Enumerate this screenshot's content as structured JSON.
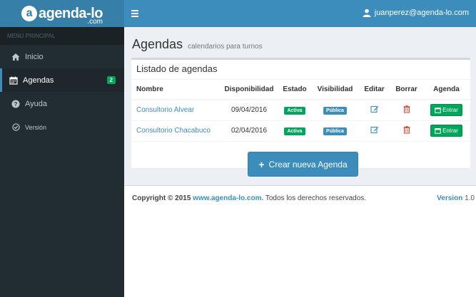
{
  "brand": {
    "mark": "a",
    "name": "agenda-lo",
    "sub": ".com"
  },
  "header": {
    "user_email": "juanperez@agenda-lo.com"
  },
  "sidebar": {
    "header": "MENU PRINCIPAL",
    "items": [
      {
        "label": "Inicio",
        "icon": "home-icon"
      },
      {
        "label": "Agendas",
        "icon": "calendar-icon",
        "badge": "2"
      },
      {
        "label": "Ayuda",
        "icon": "question-circle-icon"
      },
      {
        "label": "Versión",
        "icon": "check-circle-icon"
      }
    ]
  },
  "page": {
    "title": "Agendas",
    "subtitle": "calendarios para turnos"
  },
  "box": {
    "title": "Listado de agendas",
    "columns": [
      "Nombre",
      "Disponibilidad",
      "Estado",
      "Visibilidad",
      "Editar",
      "Borrar",
      "Agenda"
    ],
    "rows": [
      {
        "name": "Consultorio Alvear",
        "availability": "09/04/2016",
        "status": "Activa",
        "visibility": "Pública",
        "action": "Entrar"
      },
      {
        "name": "Consultorio Chacabuco",
        "availability": "02/04/2016",
        "status": "Activa",
        "visibility": "Pública",
        "action": "Entrar"
      }
    ]
  },
  "create_button": {
    "label": "Crear nueva Agenda"
  },
  "footer": {
    "copyright_prefix": "Copyright © 2015",
    "link": "www.agenda-lo.com.",
    "rights": "Todos los derechos reservados.",
    "version_label": "Version",
    "version_number": "1.0"
  },
  "colors": {
    "primary": "#3c8dbc",
    "success": "#00a65a",
    "danger": "#dd4b39",
    "sidebar": "#222d32"
  }
}
